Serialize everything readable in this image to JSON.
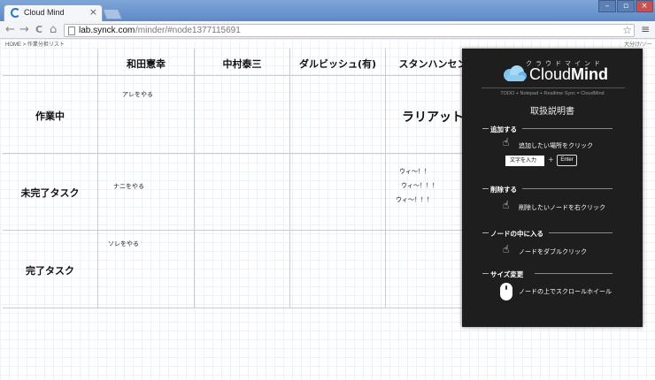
{
  "browser": {
    "tab_title": "Cloud Mind",
    "tab_close": "×",
    "url_host": "lab.synck.com",
    "url_path": "/minder/#node1377115691",
    "back_icon": "←",
    "forward_icon": "→",
    "reload_icon": "C",
    "home_icon": "⌂",
    "star_icon": "☆",
    "menu_icon": "≡",
    "win_min": "–",
    "win_max": "▫",
    "win_close": "×"
  },
  "page": {
    "breadcrumb": "HOME > 作業分担リスト",
    "top_right_link": "大分け/ソート3"
  },
  "board": {
    "columns": [
      "和田憲幸",
      "中村泰三",
      "ダルビッシュ(有)",
      "スタンハンセン"
    ],
    "rows": [
      "作業中",
      "未完了タスク",
      "完了タスク"
    ],
    "notes": {
      "r1c1": "アレをやる",
      "r1c4": "ラリアット",
      "r2c1": "ナニをやる",
      "r2c4_a": "ウィ〜！！",
      "r2c4_b": "ウィ〜！！！",
      "r2c4_c": "ウィ〜！！！",
      "r3c1": "ソレをやる"
    }
  },
  "panel": {
    "kana": "クラウドマインド",
    "brand_a": "Cloud",
    "brand_b": "Mind",
    "tagline": "TODO + Notepad + Realtime Sync = CloudMind",
    "manual_title": "取扱説明書",
    "sections": [
      {
        "head": "追加する",
        "desc": "追加したい場所をクリック"
      },
      {
        "head": "削除する",
        "desc": "削除したいノードを右クリック"
      },
      {
        "head": "ノードの中に入る",
        "desc": "ノードをダブルクリック"
      },
      {
        "head": "サイズ変更",
        "desc": "ノードの上でスクロールホイール"
      }
    ],
    "input_demo": "文字を入力",
    "plus": "+",
    "enter_key": "Enter",
    "hand_icon": "☝"
  },
  "colors": {
    "titlebar": "#6d97cf",
    "panel_bg": "#1e1e1e",
    "grid_line": "#c9ccd2"
  }
}
